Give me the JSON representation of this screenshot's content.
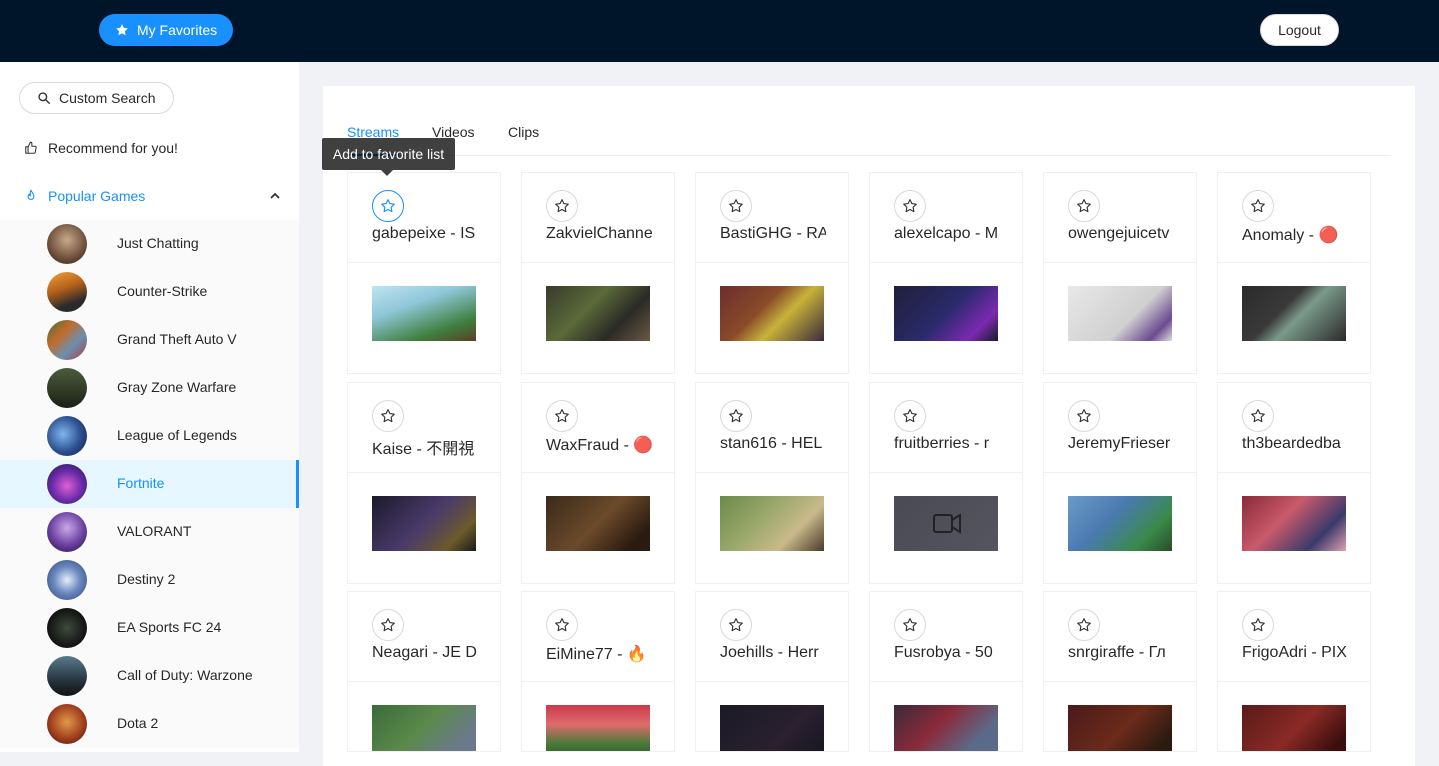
{
  "header": {
    "favorites_label": "My Favorites",
    "logout_label": "Logout"
  },
  "sidebar": {
    "search_label": "Custom Search",
    "recommend_label": "Recommend for you!",
    "popular_label": "Popular Games",
    "games": [
      {
        "label": "Just Chatting",
        "active": false
      },
      {
        "label": "Counter-Strike",
        "active": false
      },
      {
        "label": "Grand Theft Auto V",
        "active": false
      },
      {
        "label": "Gray Zone Warfare",
        "active": false
      },
      {
        "label": "League of Legends",
        "active": false
      },
      {
        "label": "Fortnite",
        "active": true
      },
      {
        "label": "VALORANT",
        "active": false
      },
      {
        "label": "Destiny 2",
        "active": false
      },
      {
        "label": "EA Sports FC 24",
        "active": false
      },
      {
        "label": "Call of Duty: Warzone",
        "active": false
      },
      {
        "label": "Dota 2",
        "active": false
      }
    ]
  },
  "tabs": [
    {
      "label": "Streams",
      "active": true
    },
    {
      "label": "Videos",
      "active": false
    },
    {
      "label": "Clips",
      "active": false
    }
  ],
  "tooltip": "Add to favorite list",
  "streams": [
    {
      "title": "gabepeixe - IS"
    },
    {
      "title": "ZakvielChanne"
    },
    {
      "title": "BastiGHG - RA"
    },
    {
      "title": "alexelcapo - M"
    },
    {
      "title": "owengejuicetv"
    },
    {
      "title": "Anomaly - 🔴"
    },
    {
      "title": "Kaise - 不開視"
    },
    {
      "title": "WaxFraud - 🔴"
    },
    {
      "title": "stan616 - HEL"
    },
    {
      "title": "fruitberries - r"
    },
    {
      "title": "JeremyFrieser"
    },
    {
      "title": "th3beardedba"
    },
    {
      "title": "Neagari - JE D"
    },
    {
      "title": "EiMine77 - 🔥"
    },
    {
      "title": "Joehills - Herr"
    },
    {
      "title": "Fusrobya - 50"
    },
    {
      "title": "snrgiraffe - Гл"
    },
    {
      "title": "FrigoAdri - PIX"
    }
  ],
  "colors": {
    "header_bg": "#001529",
    "accent": "#1890ff"
  }
}
